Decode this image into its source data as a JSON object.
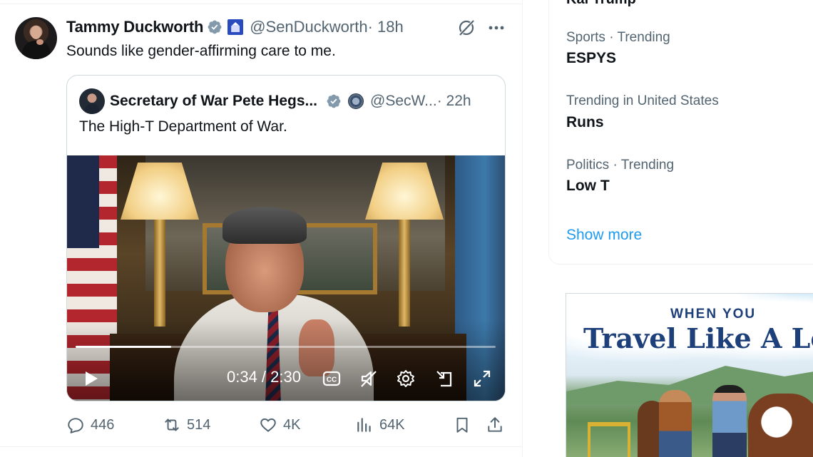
{
  "tweet": {
    "author_name": "Tammy Duckworth",
    "handle": "@SenDuckworth",
    "time": " · 18h",
    "text": "Sounds like gender-affirming care to me.",
    "icons": [
      "verified-badge",
      "capitol-flag-badge",
      "grok-icon",
      "more-icon"
    ]
  },
  "quote": {
    "author_name": "Secretary of War Pete Hegs...",
    "handle": "@SecW...",
    "time": " · 22h",
    "text": "The High-T Department of War."
  },
  "video": {
    "time": "0:34 / 2:30",
    "progress_fraction": 0.227,
    "controls": [
      "play-icon",
      "cc-icon",
      "mute-icon",
      "settings-icon",
      "pip-icon",
      "fullscreen-icon"
    ]
  },
  "actions": {
    "replies": "446",
    "reposts": "514",
    "likes": "4K",
    "views": "64K"
  },
  "sidebar": {
    "partial_trend": "Kai Trump",
    "trends": [
      {
        "meta": "Sports · Trending",
        "title": "ESPYS"
      },
      {
        "meta": "Trending in United States",
        "title": "Runs"
      },
      {
        "meta": "Politics · Trending",
        "title": "Low T"
      }
    ],
    "show_more": "Show more"
  },
  "ad": {
    "kicker": "WHEN YOU",
    "title": "Travel Like A Loc"
  },
  "colors": {
    "accent_blue": "#1d9bf0",
    "secondary_text": "#536471",
    "border": "#cfd9de",
    "verified_badge": "#829aab"
  }
}
